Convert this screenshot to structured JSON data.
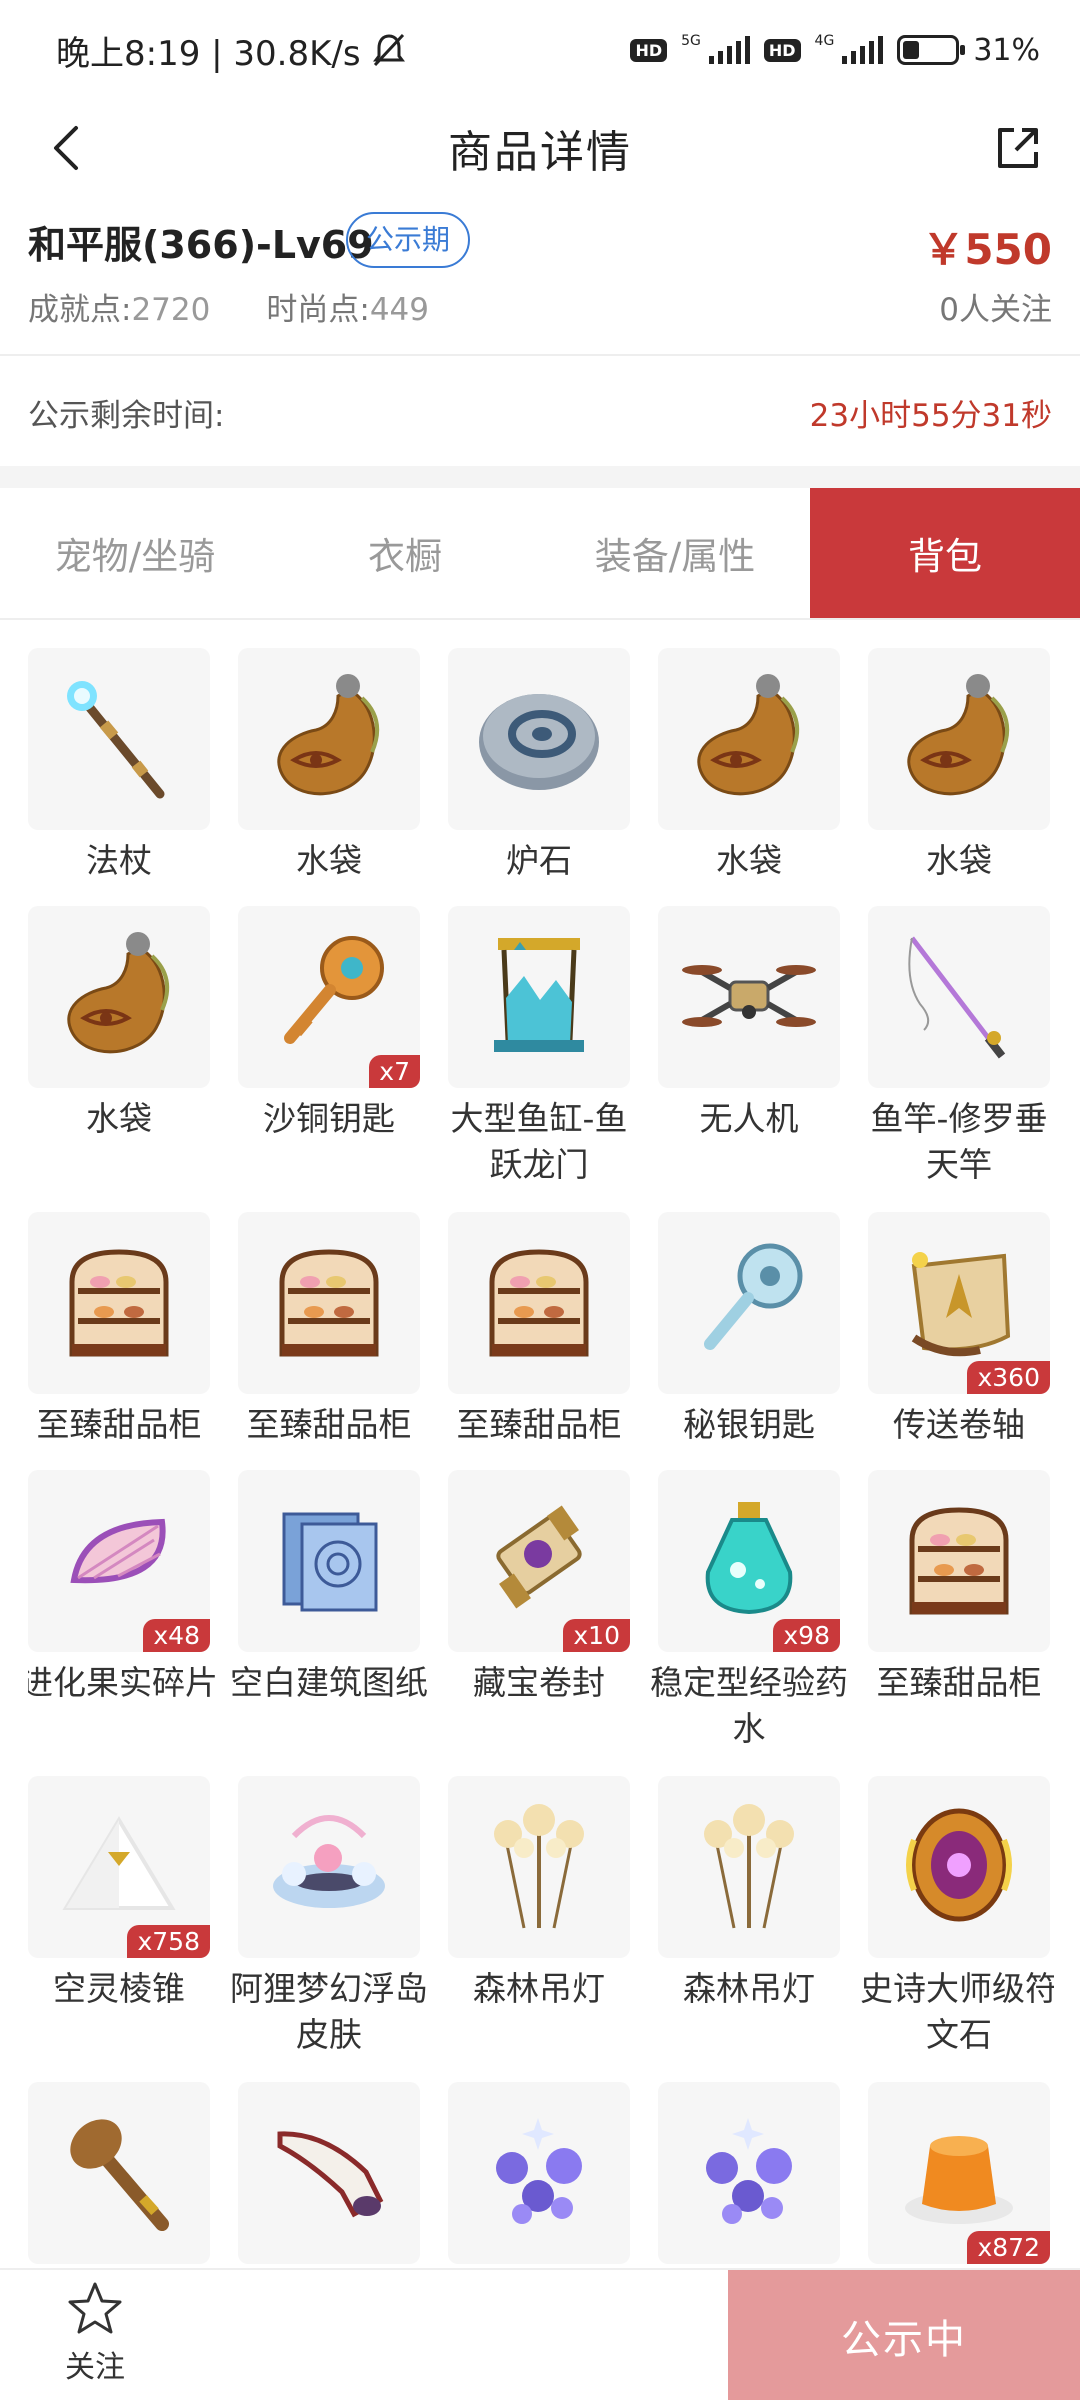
{
  "status_bar": {
    "time_speed": "晚上8:19 | 30.8K/s",
    "battery": "31%",
    "network_5g": "5G",
    "network_4g": "4G",
    "hd": "HD",
    "battery_level": 0.31
  },
  "header": {
    "title": "商品详情"
  },
  "product": {
    "name": "和平服(366)-Lv69",
    "phase_badge": "公示期",
    "achievement_label": "成就点:",
    "achievement_value": "2720",
    "fashion_label": "时尚点:",
    "fashion_value": "449",
    "price": "￥550",
    "followers": "0人关注"
  },
  "countdown": {
    "label": "公示剩余时间:",
    "value": "23小时55分31秒"
  },
  "tabs": [
    {
      "label": "宠物/坐骑",
      "active": false
    },
    {
      "label": "衣橱",
      "active": false
    },
    {
      "label": "装备/属性",
      "active": false
    },
    {
      "label": "背包",
      "active": true
    }
  ],
  "items": [
    {
      "name": "法杖",
      "icon": "staff",
      "qty": ""
    },
    {
      "name": "水袋",
      "icon": "water-bag",
      "qty": ""
    },
    {
      "name": "炉石",
      "icon": "hearthstone",
      "qty": ""
    },
    {
      "name": "水袋",
      "icon": "water-bag",
      "qty": ""
    },
    {
      "name": "水袋",
      "icon": "water-bag",
      "qty": ""
    },
    {
      "name": "水袋",
      "icon": "water-bag",
      "qty": ""
    },
    {
      "name": "沙铜钥匙",
      "icon": "bronze-key",
      "qty": "x7"
    },
    {
      "name": "大型鱼缸-鱼跃龙门",
      "icon": "fish-tank",
      "qty": ""
    },
    {
      "name": "无人机",
      "icon": "drone",
      "qty": ""
    },
    {
      "name": "鱼竿-修罗垂天竿",
      "icon": "fishing-rod",
      "qty": ""
    },
    {
      "name": "至臻甜品柜",
      "icon": "dessert-cabinet",
      "qty": ""
    },
    {
      "name": "至臻甜品柜",
      "icon": "dessert-cabinet",
      "qty": ""
    },
    {
      "name": "至臻甜品柜",
      "icon": "dessert-cabinet",
      "qty": ""
    },
    {
      "name": "秘银钥匙",
      "icon": "mithril-key",
      "qty": ""
    },
    {
      "name": "传送卷轴",
      "icon": "teleport-scroll",
      "qty": "x360"
    },
    {
      "name": "进化果实碎片",
      "icon": "fruit-fragment",
      "qty": "x48"
    },
    {
      "name": "空白建筑图纸",
      "icon": "blueprint",
      "qty": ""
    },
    {
      "name": "藏宝卷封",
      "icon": "treasure-scroll",
      "qty": "x10"
    },
    {
      "name": "稳定型经验药水",
      "icon": "exp-potion",
      "qty": "x98"
    },
    {
      "name": "至臻甜品柜",
      "icon": "dessert-cabinet",
      "qty": ""
    },
    {
      "name": "空灵棱锥",
      "icon": "pyramid",
      "qty": "x758"
    },
    {
      "name": "阿狸梦幻浮岛皮肤",
      "icon": "floating-island",
      "qty": ""
    },
    {
      "name": "森林吊灯",
      "icon": "chandelier",
      "qty": ""
    },
    {
      "name": "森林吊灯",
      "icon": "chandelier",
      "qty": ""
    },
    {
      "name": "史诗大师级符文石",
      "icon": "rune-stone",
      "qty": ""
    },
    {
      "name": "",
      "icon": "club",
      "qty": ""
    },
    {
      "name": "",
      "icon": "horn",
      "qty": ""
    },
    {
      "name": "",
      "icon": "purple-crystals",
      "qty": ""
    },
    {
      "name": "",
      "icon": "purple-crystals",
      "qty": ""
    },
    {
      "name": "",
      "icon": "jelly-pudding",
      "qty": "x872"
    }
  ],
  "bottom": {
    "follow_label": "关注",
    "status_button": "公示中"
  },
  "colors": {
    "accent": "#c9393b",
    "price": "#c0392b",
    "badge": "#3a7bd5",
    "button_disabled": "#e49a9b",
    "tile_bg": "#f6f6f6"
  }
}
